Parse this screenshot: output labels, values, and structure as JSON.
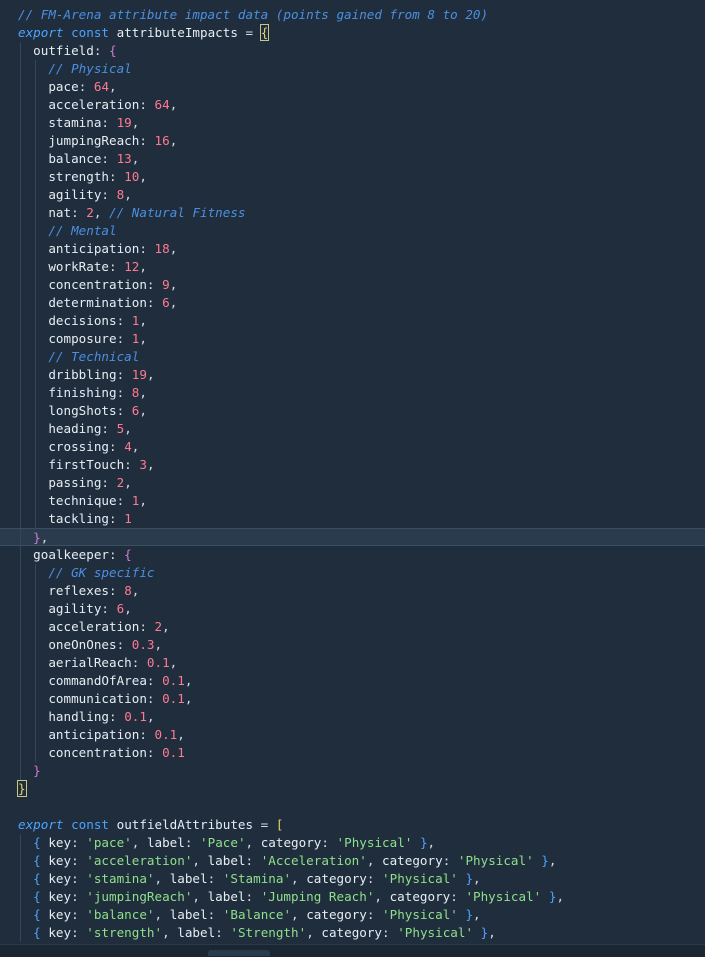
{
  "editor": {
    "header_comment": "// FM-Arena attribute impact data (points gained from 8 to 20)",
    "impacts": {
      "decl_kw": "export",
      "decl_const": "const",
      "name": "attributeImpacts",
      "outfield_key": "outfield",
      "goalkeeper_key": "goalkeeper",
      "outfield_items": [
        {
          "type": "comment",
          "text": "// Physical"
        },
        {
          "type": "pair",
          "key": "pace",
          "value": "64",
          "comma": ","
        },
        {
          "type": "pair",
          "key": "acceleration",
          "value": "64",
          "comma": ","
        },
        {
          "type": "pair",
          "key": "stamina",
          "value": "19",
          "comma": ","
        },
        {
          "type": "pair",
          "key": "jumpingReach",
          "value": "16",
          "comma": ","
        },
        {
          "type": "pair",
          "key": "balance",
          "value": "13",
          "comma": ","
        },
        {
          "type": "pair",
          "key": "strength",
          "value": "10",
          "comma": ","
        },
        {
          "type": "pair",
          "key": "agility",
          "value": "8",
          "comma": ","
        },
        {
          "type": "pair",
          "key": "nat",
          "value": "2",
          "comma": ",",
          "trail": " // Natural Fitness"
        },
        {
          "type": "comment",
          "text": "// Mental"
        },
        {
          "type": "pair",
          "key": "anticipation",
          "value": "18",
          "comma": ","
        },
        {
          "type": "pair",
          "key": "workRate",
          "value": "12",
          "comma": ","
        },
        {
          "type": "pair",
          "key": "concentration",
          "value": "9",
          "comma": ","
        },
        {
          "type": "pair",
          "key": "determination",
          "value": "6",
          "comma": ","
        },
        {
          "type": "pair",
          "key": "decisions",
          "value": "1",
          "comma": ","
        },
        {
          "type": "pair",
          "key": "composure",
          "value": "1",
          "comma": ","
        },
        {
          "type": "comment",
          "text": "// Technical"
        },
        {
          "type": "pair",
          "key": "dribbling",
          "value": "19",
          "comma": ","
        },
        {
          "type": "pair",
          "key": "finishing",
          "value": "8",
          "comma": ","
        },
        {
          "type": "pair",
          "key": "longShots",
          "value": "6",
          "comma": ","
        },
        {
          "type": "pair",
          "key": "heading",
          "value": "5",
          "comma": ","
        },
        {
          "type": "pair",
          "key": "crossing",
          "value": "4",
          "comma": ","
        },
        {
          "type": "pair",
          "key": "firstTouch",
          "value": "3",
          "comma": ","
        },
        {
          "type": "pair",
          "key": "passing",
          "value": "2",
          "comma": ","
        },
        {
          "type": "pair",
          "key": "technique",
          "value": "1",
          "comma": ","
        },
        {
          "type": "pair",
          "key": "tackling",
          "value": "1",
          "comma": ""
        }
      ],
      "goalkeeper_items": [
        {
          "type": "comment",
          "text": "// GK specific"
        },
        {
          "type": "pair",
          "key": "reflexes",
          "value": "8",
          "comma": ","
        },
        {
          "type": "pair",
          "key": "agility",
          "value": "6",
          "comma": ","
        },
        {
          "type": "pair",
          "key": "acceleration",
          "value": "2",
          "comma": ","
        },
        {
          "type": "pair",
          "key": "oneOnOnes",
          "value": "0.3",
          "comma": ","
        },
        {
          "type": "pair",
          "key": "aerialReach",
          "value": "0.1",
          "comma": ","
        },
        {
          "type": "pair",
          "key": "commandOfArea",
          "value": "0.1",
          "comma": ","
        },
        {
          "type": "pair",
          "key": "communication",
          "value": "0.1",
          "comma": ","
        },
        {
          "type": "pair",
          "key": "handling",
          "value": "0.1",
          "comma": ","
        },
        {
          "type": "pair",
          "key": "anticipation",
          "value": "0.1",
          "comma": ","
        },
        {
          "type": "pair",
          "key": "concentration",
          "value": "0.1",
          "comma": ""
        }
      ]
    },
    "outfield_attributes": {
      "decl_kw": "export",
      "decl_const": "const",
      "name": "outfieldAttributes",
      "items": [
        {
          "key": "pace",
          "label": "Pace",
          "category": "Physical"
        },
        {
          "key": "acceleration",
          "label": "Acceleration",
          "category": "Physical"
        },
        {
          "key": "stamina",
          "label": "Stamina",
          "category": "Physical"
        },
        {
          "key": "jumpingReach",
          "label": "Jumping Reach",
          "category": "Physical"
        },
        {
          "key": "balance",
          "label": "Balance",
          "category": "Physical"
        },
        {
          "key": "strength",
          "label": "Strength",
          "category": "Physical"
        }
      ]
    }
  },
  "colors": {
    "background": "#1f2d3d",
    "comment": "#4c8fe0",
    "keyword": "#4da3ff",
    "number": "#ff7a90",
    "string": "#8fe08a",
    "identifier": "#e6edf3",
    "brace_match": "#e5d36a"
  }
}
